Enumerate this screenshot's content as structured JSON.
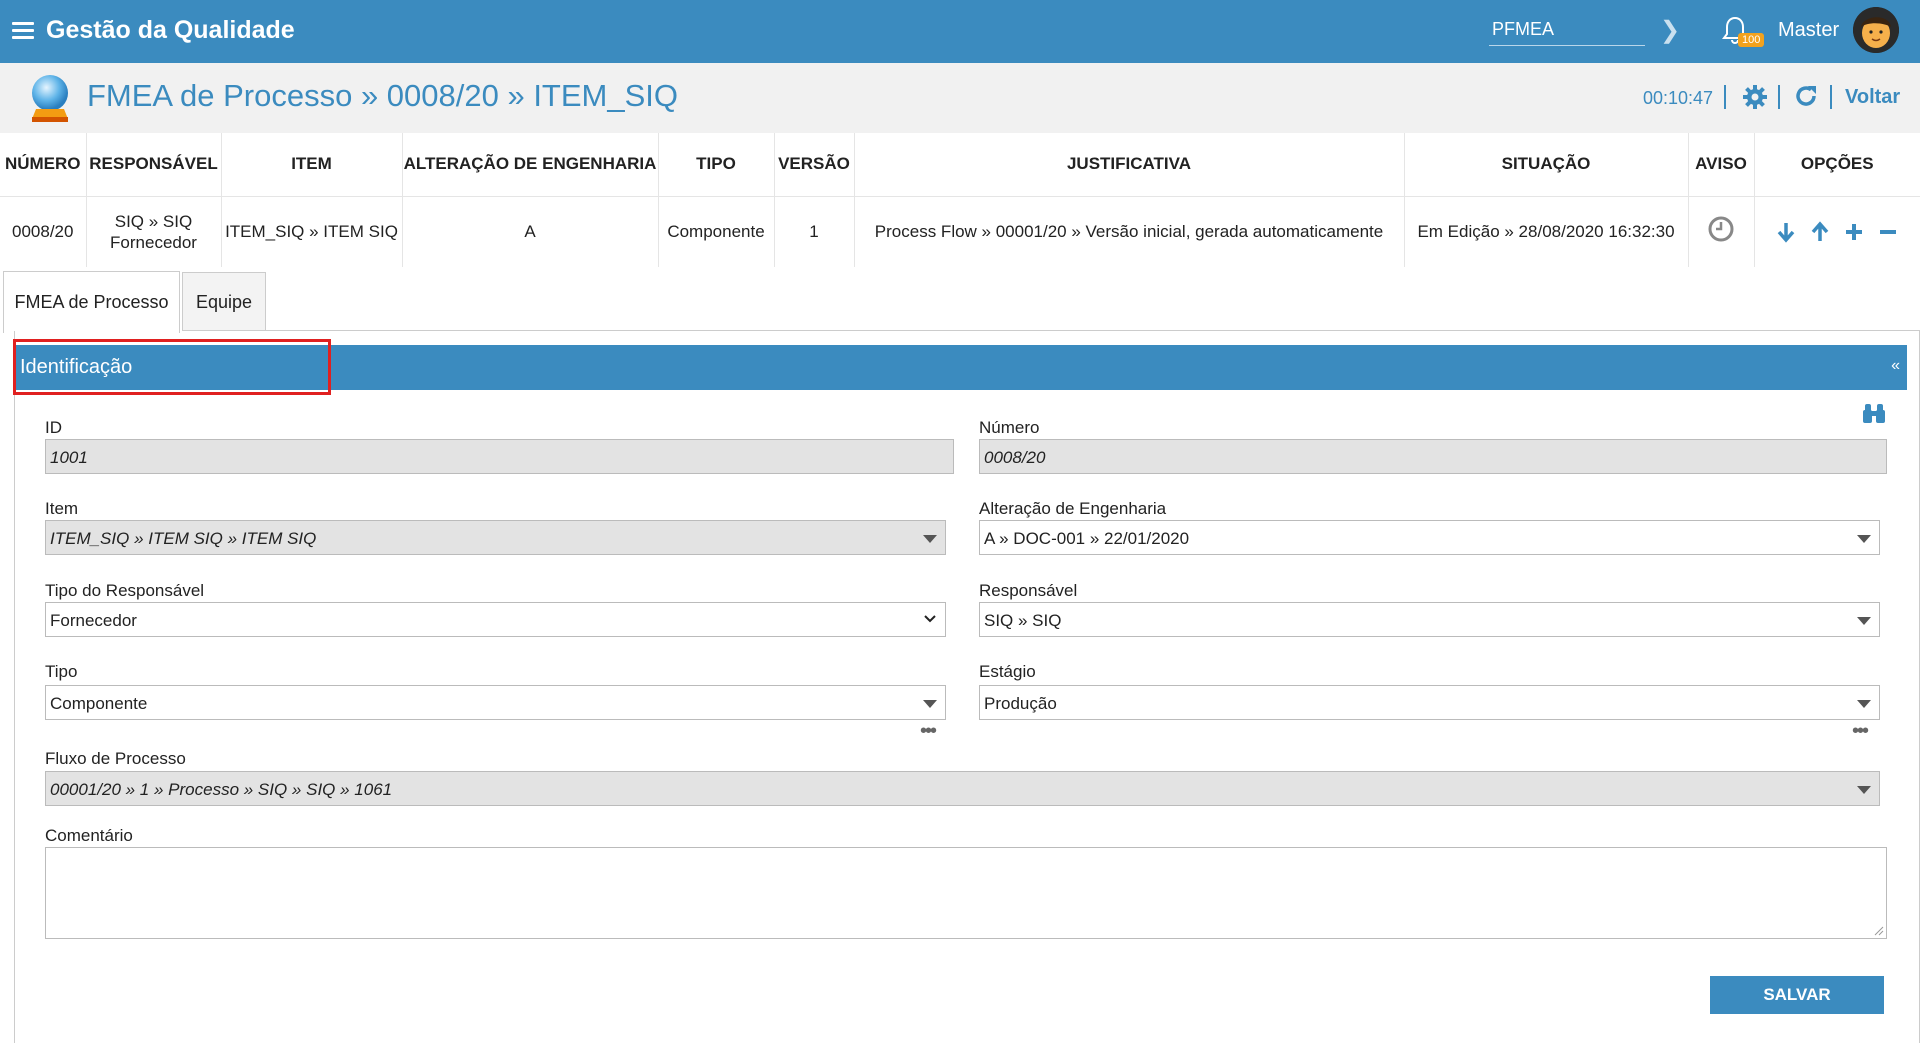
{
  "app": {
    "title": "Gestão da Qualidade",
    "module_value": "PFMEA",
    "notifications": "100",
    "user": "Master"
  },
  "header": {
    "title": "FMEA de Processo » 0008/20 » ITEM_SIQ",
    "timer": "00:10:47",
    "back_label": "Voltar"
  },
  "summary": {
    "columns": [
      "NÚMERO",
      "RESPONSÁVEL",
      "ITEM",
      "ALTERAÇÃO DE ENGENHARIA",
      "TIPO",
      "VERSÃO",
      "JUSTIFICATIVA",
      "SITUAÇÃO",
      "AVISO",
      "OPÇÕES"
    ],
    "row": {
      "numero": "0008/20",
      "responsavel_1": "SIQ » SIQ",
      "responsavel_2": "Fornecedor",
      "item": "ITEM_SIQ » ITEM SIQ",
      "alteracao": "A",
      "tipo": "Componente",
      "versao": "1",
      "justificativa": "Process Flow » 00001/20 » Versão inicial, gerada automaticamente",
      "situacao": "Em Edição » 28/08/2020 16:32:30"
    }
  },
  "tabs": [
    "FMEA de Processo",
    "Equipe"
  ],
  "section": {
    "title": "Identificação",
    "collapse": "«"
  },
  "form": {
    "id": {
      "label": "ID",
      "value": "1001"
    },
    "numero": {
      "label": "Número",
      "value": "0008/20"
    },
    "item": {
      "label": "Item",
      "value": "ITEM_SIQ » ITEM SIQ » ITEM SIQ"
    },
    "alteracao": {
      "label": "Alteração de Engenharia",
      "value": "A » DOC-001 » 22/01/2020"
    },
    "tipo_responsavel": {
      "label": "Tipo do Responsável",
      "value": "Fornecedor"
    },
    "responsavel": {
      "label": "Responsável",
      "value": "SIQ » SIQ"
    },
    "tipo": {
      "label": "Tipo",
      "value": "Componente"
    },
    "estagio": {
      "label": "Estágio",
      "value": "Produção"
    },
    "fluxo": {
      "label": "Fluxo de Processo",
      "value": "00001/20 » 1 » Processo » SIQ » SIQ » 1061"
    },
    "comentario": {
      "label": "Comentário",
      "value": ""
    },
    "save_label": "SALVAR"
  },
  "colors": {
    "brand": "#3b8bbf",
    "highlight": "#e02020",
    "badge": "#f3a21d"
  }
}
